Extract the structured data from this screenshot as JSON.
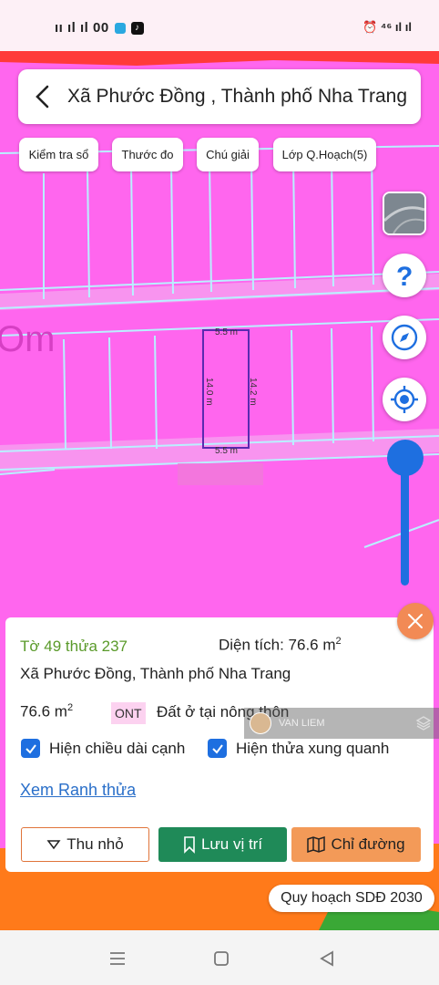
{
  "status_bar": {
    "left_text": "ıı ıl ıl 00",
    "right_text": "⁴⁶ ıl ıl"
  },
  "search": {
    "location": "Xã Phước Đồng , Thành phố Nha Trang"
  },
  "chips": [
    "Kiểm tra sổ",
    "Thước đo",
    "Chú giải",
    "Lớp Q.Hoạch(5)"
  ],
  "parcel_dims": {
    "top": "5.5 m",
    "bottom": "5.5 m",
    "left": "14.0 m",
    "right": "14.2 m"
  },
  "map_label": "Om",
  "info": {
    "parcel_id": "Tờ 49 thửa 237",
    "area_label": "Diện tích: 76.6 m",
    "area_unit_sup": "2",
    "address": "Xã Phước Đồng, Thành phố Nha Trang",
    "area_value": "76.6 m",
    "area_value_sup": "2",
    "land_code": "ONT",
    "land_type": "Đất ở tại nông thôn",
    "check_edges": "Hiện chiều dài cạnh",
    "check_neighbors": "Hiện thửa xung quanh",
    "boundary_link": "Xem Ranh thửa",
    "btn_collapse": "Thu nhỏ",
    "btn_save": "Lưu vị trí",
    "btn_directions": "Chỉ đường"
  },
  "watermark": {
    "name": "VAN LIEM"
  },
  "plan_label": "Quy hoạch SDĐ 2030",
  "colors": {
    "map_pink": "#ff66ee",
    "accent_blue": "#1e6fe0",
    "orange": "#f28a55",
    "green": "#1f8a58"
  },
  "icons": [
    "back-arrow-icon",
    "satellite-layer-icon",
    "help-icon",
    "compass-icon",
    "locate-icon",
    "close-icon",
    "chevron-down-icon",
    "bookmark-icon",
    "map-icon",
    "checkbox-icon",
    "menu-icon",
    "home-icon",
    "back-icon"
  ]
}
